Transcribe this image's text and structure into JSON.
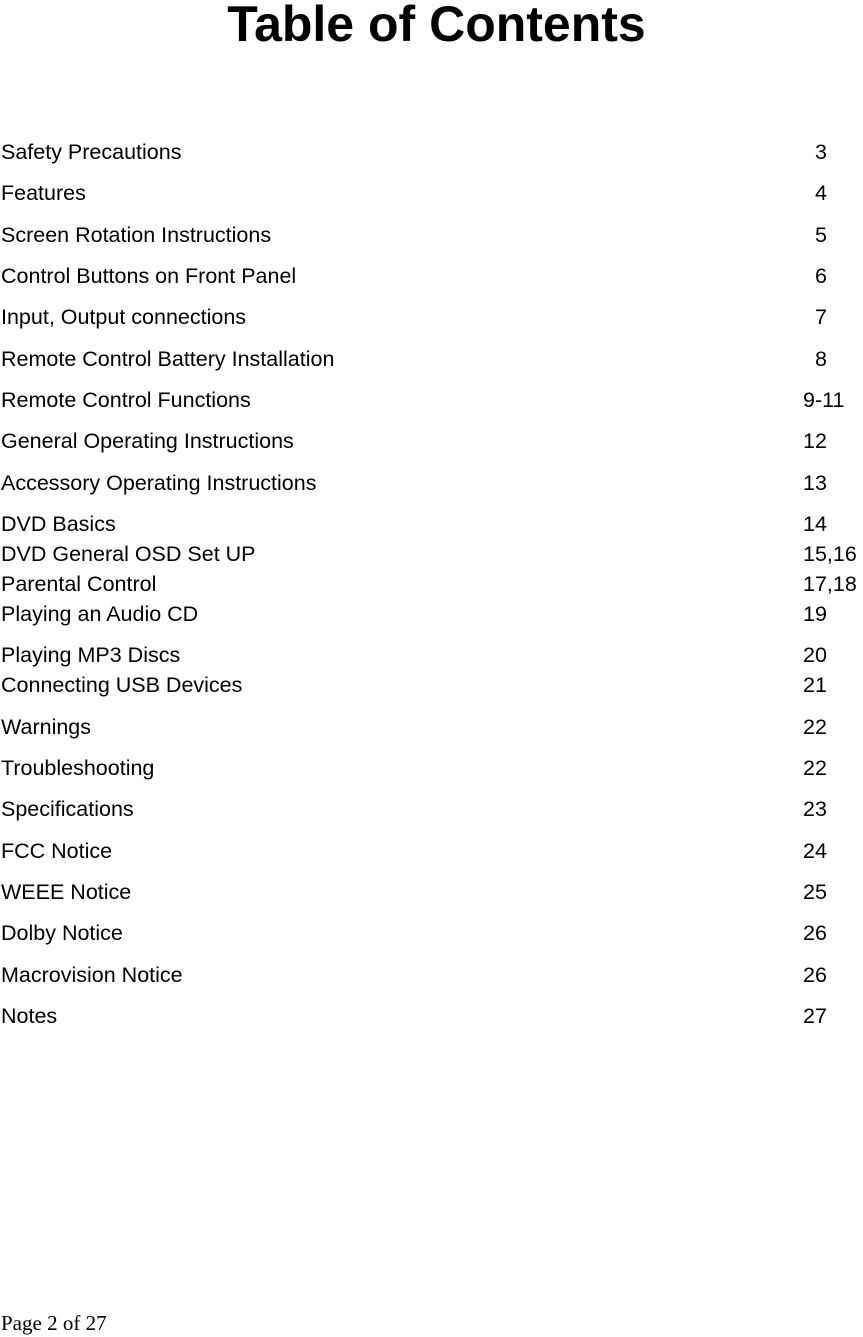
{
  "title": "Table of Contents",
  "entries": [
    {
      "label": "Safety Precautions",
      "page": "3"
    },
    {
      "label": "Features",
      "page": "4"
    },
    {
      "label": "Screen Rotation Instructions",
      "page": "5"
    },
    {
      "label": "Control Buttons on Front Panel",
      "page": "6"
    },
    {
      "label": "Input, Output connections",
      "page": "7"
    },
    {
      "label": "Remote Control Battery Installation",
      "page": "8"
    },
    {
      "label": "Remote Control Functions",
      "page": "9-11"
    },
    {
      "label": "General Operating Instructions",
      "page": "12"
    },
    {
      "label": "Accessory Operating Instructions",
      "page": "13"
    },
    {
      "label": "DVD Basics",
      "page": "14"
    },
    {
      "label": "DVD General OSD Set UP",
      "page": "15,16"
    },
    {
      "label": "Parental Control",
      "page": "17,18"
    },
    {
      "label": "Playing an Audio CD",
      "page": "19"
    },
    {
      "label": "Playing MP3 Discs",
      "page": "20"
    },
    {
      "label": "Connecting USB Devices",
      "page": "21"
    },
    {
      "label": "Warnings",
      "page": "22"
    },
    {
      "label": "Troubleshooting",
      "page": "22"
    },
    {
      "label": "Specifications",
      "page": "23"
    },
    {
      "label": "FCC Notice",
      "page": "24"
    },
    {
      "label": "WEEE Notice",
      "page": "25"
    },
    {
      "label": "Dolby Notice",
      "page": "26"
    },
    {
      "label": "Macrovision Notice",
      "page": "26"
    },
    {
      "label": "Notes",
      "page": "27"
    }
  ],
  "footer": {
    "page_indicator": "Page 2 of 27"
  }
}
